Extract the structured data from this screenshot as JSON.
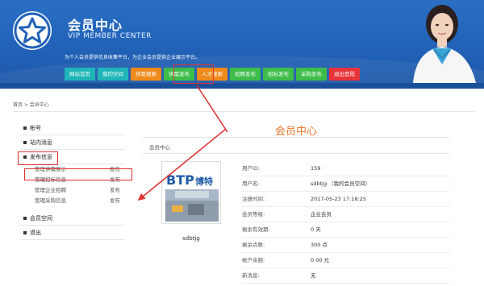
{
  "header": {
    "title": "会员中心",
    "subtitle": "VIP MEMBER CENTER",
    "tagline": "为个人会员提供信息收集平台，为企业会员提供企业展示平台。",
    "nav": [
      {
        "label": "网站首页",
        "color": "#1fb5b8"
      },
      {
        "label": "我的空间",
        "color": "#1fb5b8"
      },
      {
        "label": "供需搜索",
        "color": "#f08a1a"
      },
      {
        "label": "供需发布",
        "color": "#3dbd4a"
      },
      {
        "label": "人才搜索",
        "color": "#f08a1a"
      },
      {
        "label": "招聘发布",
        "color": "#3dbd4a"
      },
      {
        "label": "招标发布",
        "color": "#3dbd4a"
      },
      {
        "label": "采购发布",
        "color": "#3dbd4a"
      },
      {
        "label": "退出登陆",
        "color": "#e8333a"
      }
    ]
  },
  "breadcrumb": "首页 > 会员中心",
  "sidebar": {
    "items": [
      {
        "label": "帐号"
      },
      {
        "label": "站内消息"
      },
      {
        "label": "发布信息"
      }
    ],
    "sub_items": [
      {
        "label": "管理供需展示",
        "action": "发布"
      },
      {
        "label": "管理招标信息",
        "action": "发布"
      },
      {
        "label": "管理企业招聘",
        "action": "发布"
      },
      {
        "label": "管理采购信息",
        "action": "发布"
      }
    ],
    "items_after": [
      {
        "label": "会员空间"
      },
      {
        "label": "退出"
      }
    ]
  },
  "panel": {
    "title": "会员中心",
    "sub_title": "会员中心",
    "avatar_text_main": "BTP",
    "avatar_text_brand": "博特",
    "avatar_name": "sdbtjg",
    "info": [
      {
        "k": "用户ID:",
        "v": "159"
      },
      {
        "k": "用户名:",
        "v": "sdbtjg （我的会员空间）"
      },
      {
        "k": "注册时间:",
        "v": "2017-05-23 17:18:25"
      },
      {
        "k": "会员等级:",
        "v": "企业会员"
      },
      {
        "k": "剩余有效期:",
        "v": "0 天"
      },
      {
        "k": "剩余点数:",
        "v": "300 点"
      },
      {
        "k": "帐户余额:",
        "v": "0.00 元"
      },
      {
        "k": "新消息:",
        "v": "无"
      }
    ]
  },
  "colors": {
    "banner": "#2162b8",
    "accent_orange": "#e8762b",
    "highlight_red": "#e03030"
  }
}
